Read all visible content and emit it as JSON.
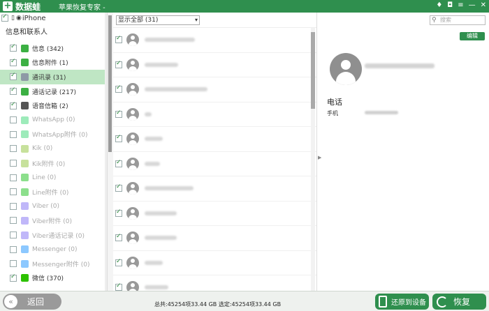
{
  "titlebar": {
    "app_name": "数据蛙",
    "subtitle": "苹果恢复专家 -",
    "controls": [
      "♦",
      "◘",
      "≡",
      "—",
      "✕"
    ]
  },
  "sidebar": {
    "device": "iPhone",
    "group_title": "信息和联系人",
    "items": [
      {
        "label": "信息 (342)",
        "checked": true,
        "enabled": true,
        "icon": "message-icon",
        "color": "#3cb043"
      },
      {
        "label": "信息附件 (1)",
        "checked": true,
        "enabled": true,
        "icon": "attachment-icon",
        "color": "#3cb043"
      },
      {
        "label": "通讯录 (31)",
        "checked": true,
        "enabled": true,
        "icon": "contacts-icon",
        "color": "#8e9aa6",
        "selected": true
      },
      {
        "label": "通话记录 (217)",
        "checked": true,
        "enabled": true,
        "icon": "phone-icon",
        "color": "#3cb043"
      },
      {
        "label": "语音信箱 (2)",
        "checked": true,
        "enabled": true,
        "icon": "voicemail-icon",
        "color": "#555"
      },
      {
        "label": "WhatsApp (0)",
        "checked": false,
        "enabled": false,
        "icon": "whatsapp-icon",
        "color": "#25d366"
      },
      {
        "label": "WhatsApp附件 (0)",
        "checked": false,
        "enabled": false,
        "icon": "whatsapp-icon",
        "color": "#25d366"
      },
      {
        "label": "Kik (0)",
        "checked": false,
        "enabled": false,
        "icon": "kik-icon",
        "color": "#82bc23"
      },
      {
        "label": "Kik附件 (0)",
        "checked": false,
        "enabled": false,
        "icon": "kik-icon",
        "color": "#82bc23"
      },
      {
        "label": "Line (0)",
        "checked": false,
        "enabled": false,
        "icon": "line-icon",
        "color": "#00b900"
      },
      {
        "label": "Line附件 (0)",
        "checked": false,
        "enabled": false,
        "icon": "line-icon",
        "color": "#00b900"
      },
      {
        "label": "Viber (0)",
        "checked": false,
        "enabled": false,
        "icon": "viber-icon",
        "color": "#7360f2"
      },
      {
        "label": "Viber附件 (0)",
        "checked": false,
        "enabled": false,
        "icon": "viber-icon",
        "color": "#7360f2"
      },
      {
        "label": "Viber通话记录 (0)",
        "checked": false,
        "enabled": false,
        "icon": "viber-icon",
        "color": "#7360f2"
      },
      {
        "label": "Messenger (0)",
        "checked": false,
        "enabled": false,
        "icon": "messenger-icon",
        "color": "#0084ff"
      },
      {
        "label": "Messenger附件 (0)",
        "checked": false,
        "enabled": false,
        "icon": "messenger-icon",
        "color": "#0084ff"
      },
      {
        "label": "微信 (370)",
        "checked": true,
        "enabled": true,
        "icon": "wechat-icon",
        "color": "#2dc100"
      }
    ]
  },
  "middle": {
    "filter_select": "显示全部 (31)",
    "rows": [
      {
        "checked": true,
        "name_width": 72
      },
      {
        "checked": true,
        "name_width": 48
      },
      {
        "checked": true,
        "name_width": 90
      },
      {
        "checked": true,
        "name_width": 10
      },
      {
        "checked": true,
        "name_width": 26
      },
      {
        "checked": true,
        "name_width": 22
      },
      {
        "checked": true,
        "name_width": 70
      },
      {
        "checked": true,
        "name_width": 46
      },
      {
        "checked": true,
        "name_width": 46
      },
      {
        "checked": true,
        "name_width": 26
      },
      {
        "checked": true,
        "name_width": 34
      }
    ]
  },
  "detail": {
    "search_placeholder": "搜索",
    "edit_label": "编辑",
    "phone_heading": "电话",
    "mobile_label": "手机"
  },
  "bottombar": {
    "back_label": "返回",
    "totals": "总共:45254项33.44 GB 选定:45254项33.44 GB",
    "restore_device_label": "还原到设备",
    "recover_label": "恢复"
  }
}
